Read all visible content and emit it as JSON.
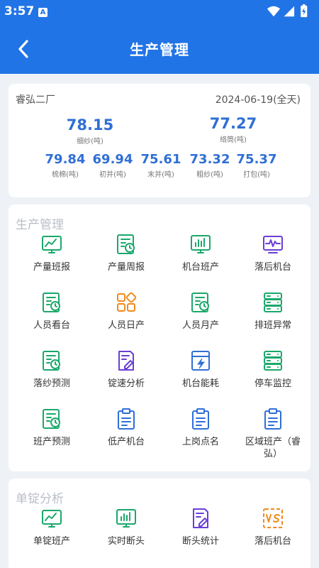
{
  "status_bar": {
    "time": "3:57",
    "notification_icon": "A"
  },
  "header": {
    "title": "生产管理",
    "back_icon": "chevron-left-icon"
  },
  "summary": {
    "factory": "睿弘二厂",
    "date": "2024-06-19(全天)",
    "primary": [
      {
        "value": "78.15",
        "label": "细纱(吨)"
      },
      {
        "value": "77.27",
        "label": "络筒(吨)"
      }
    ],
    "secondary": [
      {
        "value": "79.84",
        "label": "梳棉(吨)"
      },
      {
        "value": "69.94",
        "label": "初并(吨)"
      },
      {
        "value": "75.61",
        "label": "末并(吨)"
      },
      {
        "value": "73.32",
        "label": "粗纱(吨)"
      },
      {
        "value": "75.37",
        "label": "打包(吨)"
      }
    ]
  },
  "production_management": {
    "title": "生产管理",
    "items": [
      {
        "label": "产量班报",
        "icon": "chart-board-icon",
        "color": "#1aa86b"
      },
      {
        "label": "产量周报",
        "icon": "report-clock-icon",
        "color": "#1aa86b"
      },
      {
        "label": "机台班产",
        "icon": "bar-chart-board-icon",
        "color": "#1aa86b"
      },
      {
        "label": "落后机台",
        "icon": "monitor-wave-icon",
        "color": "#6a3fd6"
      },
      {
        "label": "人员看台",
        "icon": "report-clock-icon",
        "color": "#1aa86b"
      },
      {
        "label": "人员日产",
        "icon": "apps-grid-icon",
        "color": "#f08a1c"
      },
      {
        "label": "人员月产",
        "icon": "report-clock-icon",
        "color": "#1aa86b"
      },
      {
        "label": "排班异常",
        "icon": "server-stack-icon",
        "color": "#1aa86b"
      },
      {
        "label": "落纱预测",
        "icon": "report-clock-icon",
        "color": "#1aa86b"
      },
      {
        "label": "锭速分析",
        "icon": "document-edit-icon",
        "color": "#6a3fd6"
      },
      {
        "label": "机台能耗",
        "icon": "energy-bolt-icon",
        "color": "#2f6fd6"
      },
      {
        "label": "停车监控",
        "icon": "server-stack-icon",
        "color": "#1aa86b"
      },
      {
        "label": "班产预测",
        "icon": "report-clock-icon",
        "color": "#1aa86b"
      },
      {
        "label": "低产机台",
        "icon": "clipboard-icon",
        "color": "#2f6fd6"
      },
      {
        "label": "上岗点名",
        "icon": "clipboard-icon",
        "color": "#2f6fd6"
      },
      {
        "label": "区域班产（睿弘）",
        "icon": "clipboard-icon",
        "color": "#2f6fd6"
      }
    ]
  },
  "single_spindle_analysis": {
    "title": "单锭分析",
    "items": [
      {
        "label": "单锭班产",
        "icon": "chart-board-icon",
        "color": "#1aa86b"
      },
      {
        "label": "实时断头",
        "icon": "bar-chart-board-icon",
        "color": "#1aa86b"
      },
      {
        "label": "断头统计",
        "icon": "document-edit-icon",
        "color": "#6a3fd6"
      },
      {
        "label": "落后机台",
        "icon": "vs-compare-icon",
        "color": "#f08a1c"
      }
    ]
  }
}
